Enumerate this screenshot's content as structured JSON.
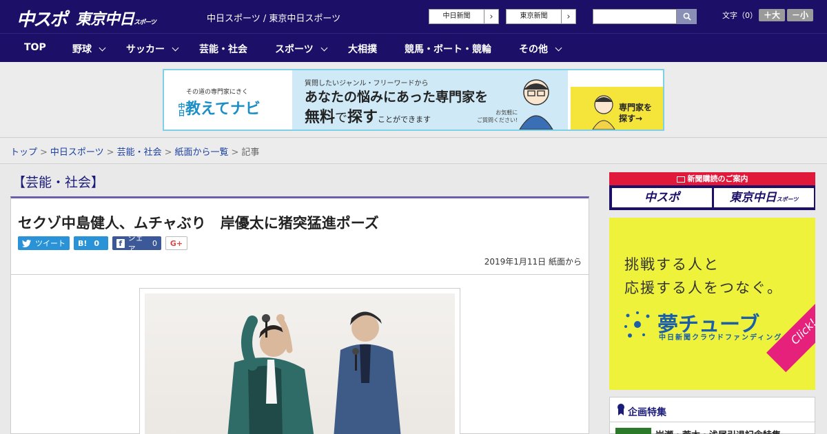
{
  "header": {
    "logo_chuspo": "中スポ",
    "logo_tokyo": "東京中日",
    "logo_tokyo_small": "スポーツ",
    "site_names": "中日スポーツ / 東京中日スポーツ",
    "paper_buttons": [
      {
        "label": "中日新聞",
        "arrow": "›"
      },
      {
        "label": "東京新聞",
        "arrow": "›"
      }
    ],
    "search_placeholder": "",
    "font_size_label": "文字（0）",
    "font_increase": "＋大",
    "font_decrease": "－小"
  },
  "nav": {
    "items": [
      {
        "label": "TOP",
        "has_dropdown": false
      },
      {
        "label": "野球",
        "has_dropdown": true
      },
      {
        "label": "サッカー",
        "has_dropdown": true
      },
      {
        "label": "芸能・社会",
        "has_dropdown": false
      },
      {
        "label": "スポーツ",
        "has_dropdown": true
      },
      {
        "label": "大相撲",
        "has_dropdown": false
      },
      {
        "label": "競馬・ボート・競輪",
        "has_dropdown": false
      },
      {
        "label": "その他",
        "has_dropdown": true
      }
    ]
  },
  "ad_banner": {
    "small_text": "その道の専門家にきく",
    "logo_prefix": "中日",
    "logo": "教えてナビ",
    "line1": "質問したいジャンル・フリーワードから",
    "line2": "あなたの悩みにあった専門家を",
    "line3_a": "無料",
    "line3_b": "で",
    "line3_c": "探す",
    "line3_d": "ことができます",
    "note_line1": "お気軽に",
    "note_line2": "ご質問ください!",
    "cta_line1": "専門家を",
    "cta_line2": "探す→",
    "accent_color": "#7ed0e6"
  },
  "breadcrumb": {
    "items": [
      "トップ",
      "中日スポーツ",
      "芸能・社会",
      "紙面から一覧"
    ],
    "current": "記事",
    "separator": ">"
  },
  "article": {
    "category": "【芸能・社会】",
    "title": "セクゾ中島健人、ムチャぶり　岸優太に猪突猛進ポーズ",
    "share": {
      "tweet": "ツイート",
      "hatena_label": "B!",
      "hatena_count": "0",
      "facebook_label": "シェア",
      "facebook_count": "0",
      "gplus": "G+"
    },
    "date": "2019年1月11日 紙面から"
  },
  "sidebar": {
    "subscription_heading": "新聞購読のご案内",
    "paper1": "中スポ",
    "paper2": "東京中日",
    "paper2_small": "スポーツ",
    "ad_line1": "挑戦する人と",
    "ad_line2": "応援する人をつなぐ。",
    "ad_brand": "夢チューブ",
    "ad_sub": "中日新聞クラウドファンディング",
    "ad_click": "Click!",
    "feature_title": "企画特集",
    "feature_item": "岩瀬・荒木・浅尾引退記念特集"
  },
  "colors": {
    "header_bg": "#1b0f68",
    "category_color": "#1b1b7a",
    "subscription_red": "#e0193b",
    "ad_yellow": "#eef23a"
  }
}
